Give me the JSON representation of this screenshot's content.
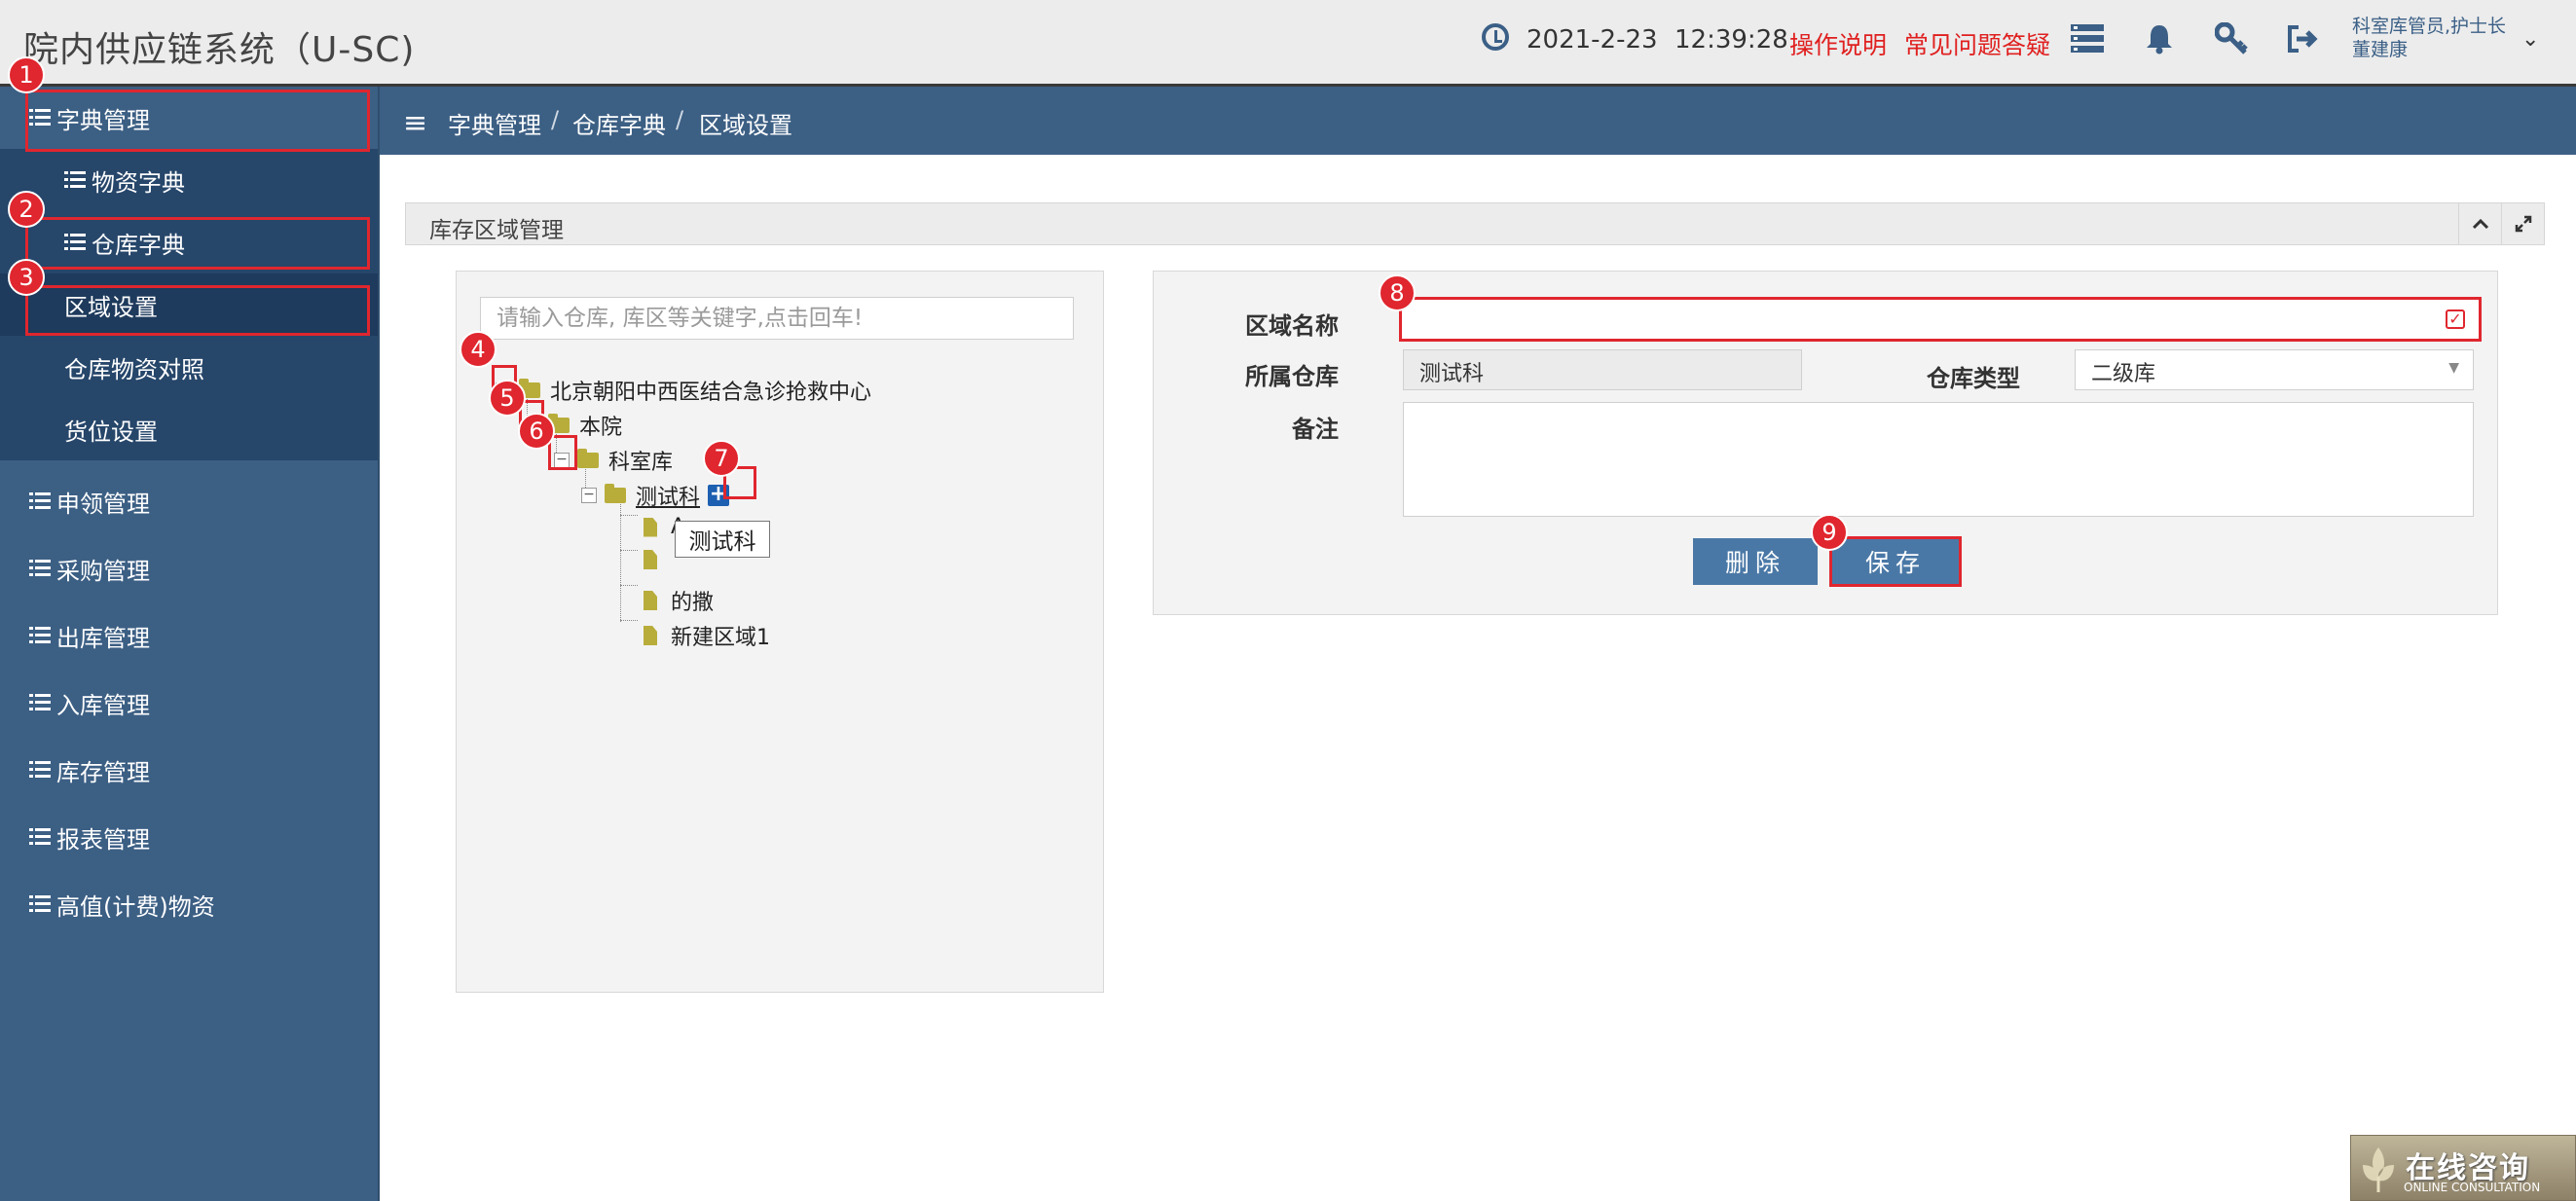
{
  "header": {
    "app_title": "院内供应链系统（U-SC)",
    "date": "2021-2-23",
    "time": "12:39:28",
    "help_link": "操作说明",
    "faq_link": "常见问题答疑",
    "user_role": "科室库管员,护士长",
    "user_name": "董建康",
    "icons": [
      "clock-icon",
      "menu-stack-icon",
      "bell-icon",
      "key-icon",
      "logout-icon",
      "chevron-down-icon"
    ]
  },
  "sidebar": {
    "items": [
      {
        "label": "字典管理"
      },
      {
        "label": "物资字典"
      },
      {
        "label": "仓库字典"
      },
      {
        "label": "区域设置"
      },
      {
        "label": "仓库物资对照"
      },
      {
        "label": "货位设置"
      },
      {
        "label": "申领管理"
      },
      {
        "label": "采购管理"
      },
      {
        "label": "出库管理"
      },
      {
        "label": "入库管理"
      },
      {
        "label": "库存管理"
      },
      {
        "label": "报表管理"
      },
      {
        "label": "高值(计费)物资"
      }
    ]
  },
  "breadcrumb": [
    "字典管理",
    "仓库字典",
    "区域设置"
  ],
  "breadcrumb_sep": "/",
  "panel": {
    "title": "库存区域管理"
  },
  "tree": {
    "search_placeholder": "请输入仓库, 库区等关键字,点击回车!",
    "nodes": [
      {
        "label": "北京朝阳中西医结合急诊抢救中心"
      },
      {
        "label": "本院"
      },
      {
        "label": "科室库"
      },
      {
        "label": "测试科"
      },
      {
        "label": "A"
      },
      {
        "label": ""
      },
      {
        "label": "的撒"
      },
      {
        "label": "新建区域1"
      }
    ],
    "tooltip": "测试科",
    "toggle_minus": "−",
    "add_symbol": "+"
  },
  "form": {
    "area_name_label": "区域名称",
    "area_name_value": "",
    "warehouse_label": "所属仓库",
    "warehouse_value": "测试科",
    "type_label": "仓库类型",
    "type_value": "二级库",
    "remark_label": "备注",
    "remark_value": "",
    "delete_label": "删除",
    "save_label": "保存"
  },
  "annotations": [
    "1",
    "2",
    "3",
    "4",
    "5",
    "6",
    "7",
    "8",
    "9"
  ],
  "consult": {
    "cn": "在线咨询",
    "en": "ONLINE CONSULTATION"
  },
  "colors": {
    "nav": "#3c5f84",
    "nav_dark": "#26466a",
    "accent_red": "#e0262e",
    "button": "#4a78a6",
    "folder": "#b8ad3a"
  }
}
